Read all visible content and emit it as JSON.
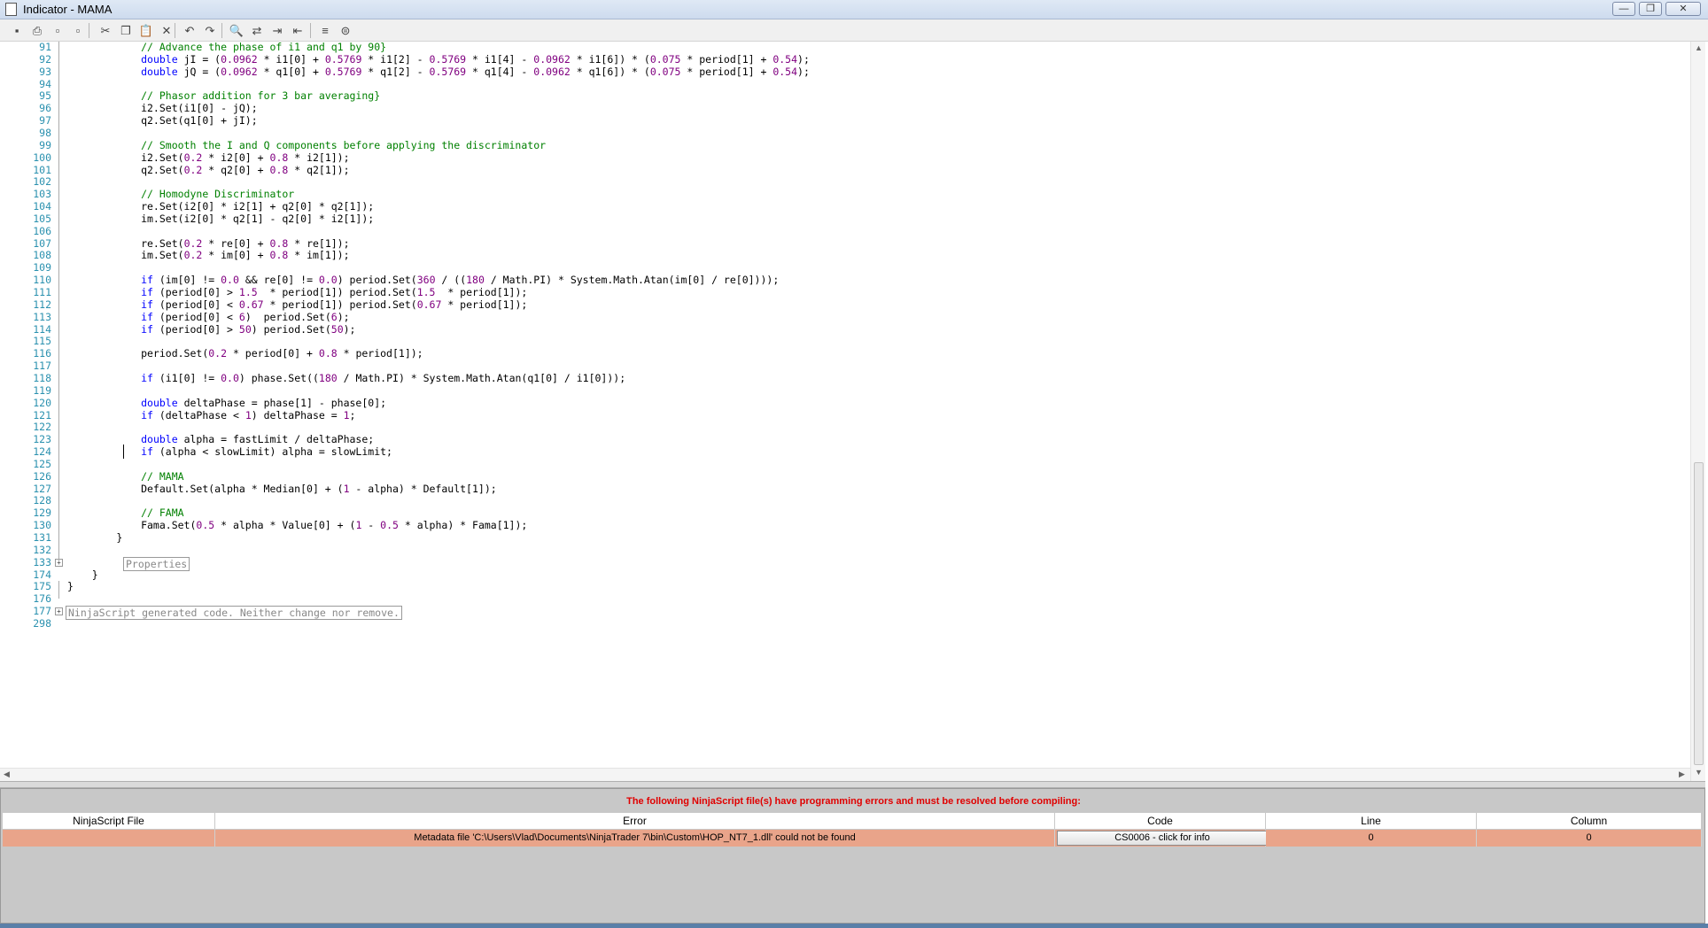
{
  "window": {
    "title": "Indicator - MAMA",
    "min_glyph": "—",
    "max_glyph": "❐",
    "close_glyph": "✕"
  },
  "toolbar": {
    "icons": [
      "save-icon",
      "print-icon",
      "print-preview-icon",
      "page-setup-icon",
      "cut-icon",
      "copy-icon",
      "paste-icon",
      "delete-icon",
      "undo-icon",
      "redo-icon",
      "find-icon",
      "replace-icon",
      "indent-icon",
      "outdent-icon",
      "comment-icon",
      "uncomment-icon"
    ],
    "glyphs": [
      "▪",
      "⎙",
      "▫",
      "▫",
      "✂",
      "❐",
      "📋",
      "✕",
      "↶",
      "↷",
      "🔍",
      "⇄",
      "⇥",
      "⇤",
      "≡",
      "⊜"
    ]
  },
  "editor": {
    "lines": [
      {
        "n": "91",
        "text": "            // Advance the phase of i1 and q1 by 90}"
      },
      {
        "n": "92",
        "text": "            double jI = (0.0962 * i1[0] + 0.5769 * i1[2] - 0.5769 * i1[4] - 0.0962 * i1[6]) * (0.075 * period[1] + 0.54);"
      },
      {
        "n": "93",
        "text": "            double jQ = (0.0962 * q1[0] + 0.5769 * q1[2] - 0.5769 * q1[4] - 0.0962 * q1[6]) * (0.075 * period[1] + 0.54);"
      },
      {
        "n": "94",
        "text": ""
      },
      {
        "n": "95",
        "text": "            // Phasor addition for 3 bar averaging}"
      },
      {
        "n": "96",
        "text": "            i2.Set(i1[0] - jQ);"
      },
      {
        "n": "97",
        "text": "            q2.Set(q1[0] + jI);"
      },
      {
        "n": "98",
        "text": ""
      },
      {
        "n": "99",
        "text": "            // Smooth the I and Q components before applying the discriminator"
      },
      {
        "n": "100",
        "text": "            i2.Set(0.2 * i2[0] + 0.8 * i2[1]);"
      },
      {
        "n": "101",
        "text": "            q2.Set(0.2 * q2[0] + 0.8 * q2[1]);"
      },
      {
        "n": "102",
        "text": ""
      },
      {
        "n": "103",
        "text": "            // Homodyne Discriminator"
      },
      {
        "n": "104",
        "text": "            re.Set(i2[0] * i2[1] + q2[0] * q2[1]);"
      },
      {
        "n": "105",
        "text": "            im.Set(i2[0] * q2[1] - q2[0] * i2[1]);"
      },
      {
        "n": "106",
        "text": ""
      },
      {
        "n": "107",
        "text": "            re.Set(0.2 * re[0] + 0.8 * re[1]);"
      },
      {
        "n": "108",
        "text": "            im.Set(0.2 * im[0] + 0.8 * im[1]);"
      },
      {
        "n": "109",
        "text": ""
      },
      {
        "n": "110",
        "text": "            if (im[0] != 0.0 && re[0] != 0.0) period.Set(360 / ((180 / Math.PI) * System.Math.Atan(im[0] / re[0])));"
      },
      {
        "n": "111",
        "text": "            if (period[0] > 1.5  * period[1]) period.Set(1.5  * period[1]);"
      },
      {
        "n": "112",
        "text": "            if (period[0] < 0.67 * period[1]) period.Set(0.67 * period[1]);"
      },
      {
        "n": "113",
        "text": "            if (period[0] < 6)  period.Set(6);"
      },
      {
        "n": "114",
        "text": "            if (period[0] > 50) period.Set(50);"
      },
      {
        "n": "115",
        "text": ""
      },
      {
        "n": "116",
        "text": "            period.Set(0.2 * period[0] + 0.8 * period[1]);"
      },
      {
        "n": "117",
        "text": ""
      },
      {
        "n": "118",
        "text": "            if (i1[0] != 0.0) phase.Set((180 / Math.PI) * System.Math.Atan(q1[0] / i1[0]));"
      },
      {
        "n": "119",
        "text": ""
      },
      {
        "n": "120",
        "text": "            double deltaPhase = phase[1] - phase[0];"
      },
      {
        "n": "121",
        "text": "            if (deltaPhase < 1) deltaPhase = 1;"
      },
      {
        "n": "122",
        "text": ""
      },
      {
        "n": "123",
        "text": "            double alpha = fastLimit / deltaPhase;"
      },
      {
        "n": "124",
        "text": "            if (alpha < slowLimit) alpha = slowLimit;"
      },
      {
        "n": "125",
        "text": ""
      },
      {
        "n": "126",
        "text": "            // MAMA"
      },
      {
        "n": "127",
        "text": "            Default.Set(alpha * Median[0] + (1 - alpha) * Default[1]);"
      },
      {
        "n": "128",
        "text": ""
      },
      {
        "n": "129",
        "text": "            // FAMA"
      },
      {
        "n": "130",
        "text": "            Fama.Set(0.5 * alpha * Value[0] + (1 - 0.5 * alpha) * Fama[1]);"
      },
      {
        "n": "131",
        "text": "        }"
      },
      {
        "n": "132",
        "text": ""
      },
      {
        "n": "133",
        "text": ""
      },
      {
        "n": "174",
        "text": "    }"
      },
      {
        "n": "175",
        "text": "}"
      },
      {
        "n": "176",
        "text": ""
      },
      {
        "n": "177",
        "text": ""
      },
      {
        "n": "298",
        "text": ""
      }
    ],
    "collapsed_regions": [
      {
        "line": "133",
        "label": "Properties"
      },
      {
        "line": "177",
        "label": "NinjaScript generated code. Neither change nor remove."
      }
    ],
    "colors": {
      "line_number": "#2b91af",
      "keyword": "#0000ff",
      "comment": "#008000",
      "number": "#800080"
    }
  },
  "errors": {
    "message": "The following NinjaScript file(s) have programming errors and must be resolved before compiling:",
    "columns": [
      "NinjaScript File",
      "Error",
      "Code",
      "Line",
      "Column"
    ],
    "rows": [
      {
        "file": "",
        "error": "Metadata file 'C:\\Users\\Vlad\\Documents\\NinjaTrader 7\\bin\\Custom\\HOP_NT7_1.dll' could not be found",
        "code": "CS0006 - click for info",
        "line": "0",
        "column": "0"
      }
    ],
    "row_color": "#e9a48a"
  }
}
